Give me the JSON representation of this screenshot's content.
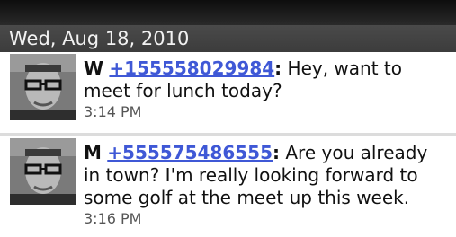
{
  "date_header": "Wed, Aug 18, 2010",
  "messages": [
    {
      "sender": "W",
      "phone": "+155558029984",
      "text": "Hey, want to meet for lunch today?",
      "time": "3:14 PM",
      "avatar_icon": "contact-photo"
    },
    {
      "sender": "M",
      "phone": "+555575486555",
      "text": "Are you already in town? I'm really looking forward to some golf at the meet up this week.",
      "time": "3:16 PM",
      "avatar_icon": "contact-photo"
    }
  ],
  "colors": {
    "link": "#3f58d6",
    "header_bg": "#444444",
    "divider": "#dcdcdc"
  }
}
